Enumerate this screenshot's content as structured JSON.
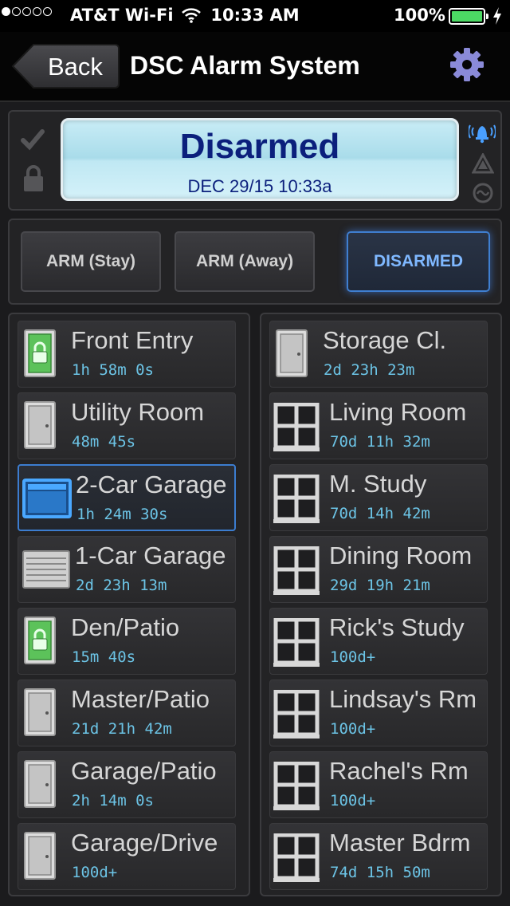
{
  "status_bar": {
    "carrier": "AT&T Wi-Fi",
    "time": "10:33 AM",
    "battery": "100%",
    "signal_bars_filled": 1,
    "signal_bars_total": 5
  },
  "nav": {
    "back_label": "Back",
    "title": "DSC Alarm System"
  },
  "status": {
    "state": "Disarmed",
    "datetime": "DEC 29/15 10:33a"
  },
  "modes": [
    {
      "label": "ARM (Stay)",
      "active": false
    },
    {
      "label": "ARM (Away)",
      "active": false
    },
    {
      "label": "DISARMED",
      "active": true
    }
  ],
  "zones_left": [
    {
      "name": "Front Entry",
      "time": "1h 58m 0s",
      "icon": "locked-door-icon"
    },
    {
      "name": "Utility Room",
      "time": "48m 45s",
      "icon": "door-icon"
    },
    {
      "name": "2-Car Garage",
      "time": "1h 24m 30s",
      "icon": "garage-open-icon"
    },
    {
      "name": "1-Car Garage",
      "time": "2d 23h 13m",
      "icon": "garage-closed-icon"
    },
    {
      "name": "Den/Patio",
      "time": "15m 40s",
      "icon": "locked-door-icon"
    },
    {
      "name": "Master/Patio",
      "time": "21d 21h 42m",
      "icon": "door-icon"
    },
    {
      "name": "Garage/Patio",
      "time": "2h 14m 0s",
      "icon": "door-icon"
    },
    {
      "name": "Garage/Drive",
      "time": "100d+",
      "icon": "door-icon"
    }
  ],
  "zones_right": [
    {
      "name": "Storage Cl.",
      "time": "2d 23h 23m",
      "icon": "door-icon"
    },
    {
      "name": "Living Room",
      "time": "70d 11h 32m",
      "icon": "window-icon"
    },
    {
      "name": "M. Study",
      "time": "70d 14h 42m",
      "icon": "window-icon"
    },
    {
      "name": "Dining Room",
      "time": "29d 19h 21m",
      "icon": "window-icon"
    },
    {
      "name": "Rick's Study",
      "time": "100d+",
      "icon": "window-icon"
    },
    {
      "name": "Lindsay's Rm",
      "time": "100d+",
      "icon": "window-icon"
    },
    {
      "name": "Rachel's Rm",
      "time": "100d+",
      "icon": "window-icon"
    },
    {
      "name": "Master Bdrm",
      "time": "74d 15h 50m",
      "icon": "window-icon"
    }
  ],
  "colors": {
    "accent_blue": "#3f7fd0",
    "lcd_text": "#0b1f7c",
    "zone_time": "#6cc4e6",
    "locked_green": "#5cc25a"
  }
}
